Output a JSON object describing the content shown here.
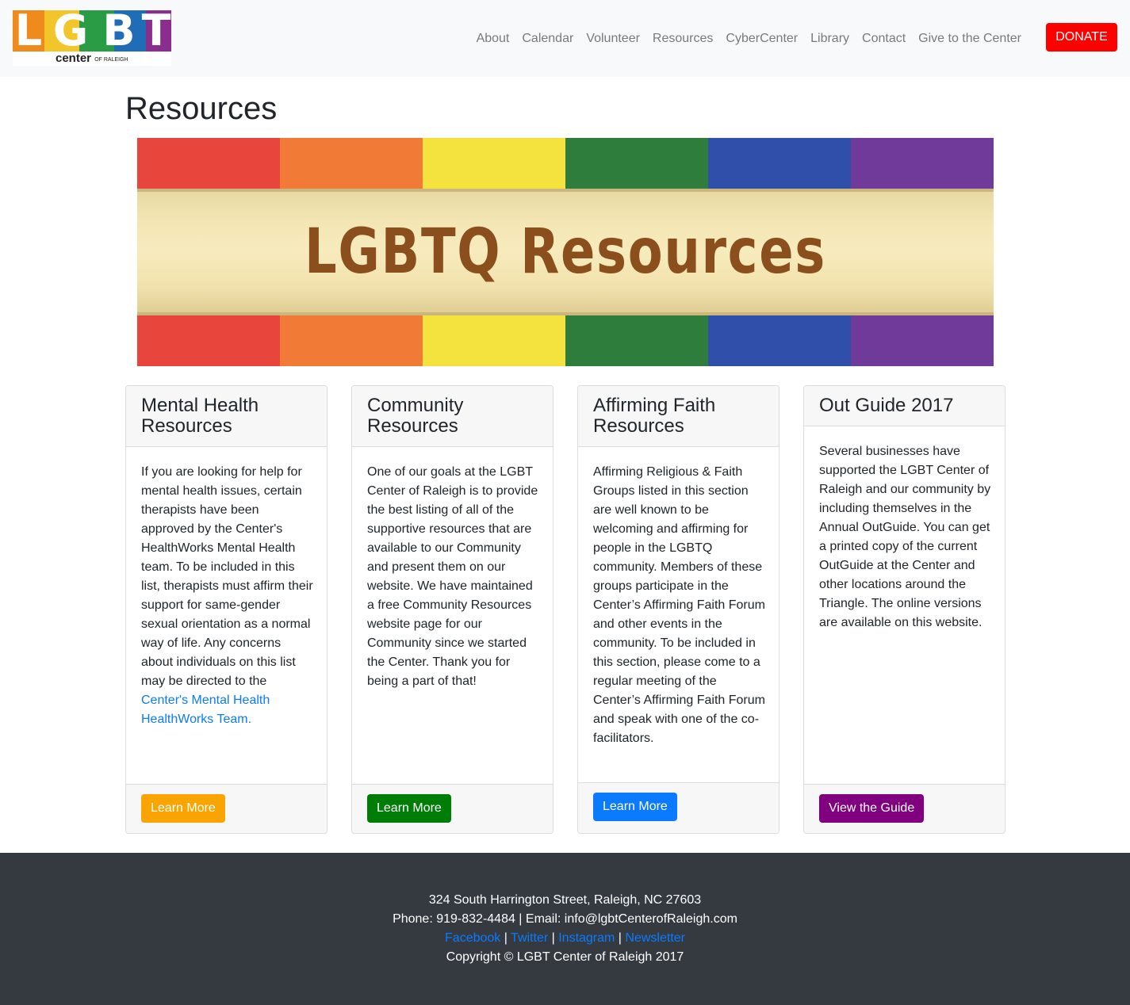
{
  "brand": {
    "letters": [
      "L",
      "G",
      "B",
      "T"
    ],
    "center_text": "center",
    "center_small": "OF RALEIGH",
    "colors": [
      "#ef8a1d",
      "#f2c52a",
      "#2a9c45",
      "#1e6db6",
      "#8b2d8e"
    ]
  },
  "nav": {
    "links": [
      "About",
      "Calendar",
      "Volunteer",
      "Resources",
      "CyberCenter",
      "Library",
      "Contact",
      "Give to the Center"
    ],
    "donate_label": "DONATE"
  },
  "page": {
    "title": "Resources"
  },
  "banner": {
    "text": "LGBTQ Resources",
    "stripe_colors": [
      "#e8453c",
      "#f07a36",
      "#f4e33f",
      "#2f7d3c",
      "#2f4faa",
      "#6f3a9a"
    ]
  },
  "cards": [
    {
      "title": "Mental Health Resources",
      "body": "If you are looking for help for mental health issues, certain therapists have been approved by the Center's HealthWorks Mental Health team. To be included in this list, therapists must affirm their support for same-gender sexual orientation as a normal way of life. Any concerns about individuals on this list may be directed to the ",
      "link_text": "Center's Mental Health HealthWorks Team.",
      "button_label": "Learn More",
      "button_color": "#f9a400"
    },
    {
      "title": "Community Resources",
      "body": "One of our goals at the LGBT Center of Raleigh is to provide the best listing of all of the supportive resources that are available to our Community and present them on our website. We have maintained a free Community Resources website page for our Community since we started the Center. Thank you for being a part of that!",
      "button_label": "Learn More",
      "button_color": "#007d07"
    },
    {
      "title": "Affirming Faith Resources",
      "body": "Affirming Religious & Faith Groups listed in this section are well known to be welcoming and affirming for people in the LGBTQ community. Members of these groups participate in the Center’s Affirming Faith Forum and other events in the community. To be included in this section, please come to a regular meeting of the Center’s Affirming Faith Forum and speak with one of the co-facilitators.",
      "button_label": "Learn More",
      "button_color": "#0a7bff"
    },
    {
      "title": "Out Guide 2017",
      "body": "Several businesses have supported the LGBT Center of Raleigh and our community by including themselves in the Annual OutGuide. You can get a printed copy of the current OutGuide at the Center and other locations around the Triangle. The online versions are available on this website.",
      "button_label": "View the Guide",
      "button_color": "#800080"
    }
  ],
  "footer": {
    "address": "324 South Harrington Street, Raleigh, NC 27603",
    "contact": "Phone: 919-832-4484 | Email: info@lgbtCenterofRaleigh.com",
    "social": [
      "Facebook",
      "Twitter",
      "Instagram",
      "Newsletter"
    ],
    "separator": " | ",
    "copyright": "Copyright © LGBT Center of Raleigh 2017"
  }
}
